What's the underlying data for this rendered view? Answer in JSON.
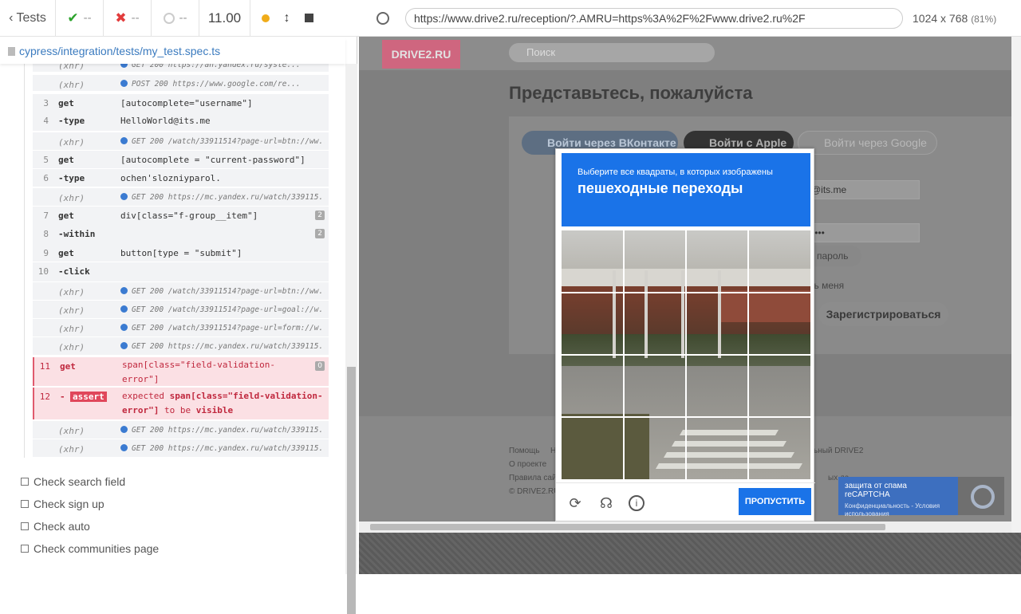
{
  "reporter": {
    "header": {
      "tests_label": "Tests",
      "passed": "--",
      "failed": "--",
      "pending": "--",
      "duration": "11.00"
    },
    "spec_path": "cypress/integration/tests/my_test.spec.ts",
    "commands": [
      {
        "type": "xhr",
        "name": "(xhr)",
        "msg": "GET 200 https://an.yandex.ru/syste..."
      },
      {
        "type": "xhr",
        "name": "(xhr)",
        "msg": "POST 200 https://www.google.com/re..."
      },
      {
        "num": "3",
        "name": "get",
        "msg": "[autocomplete=\"username\"]"
      },
      {
        "num": "4",
        "name": "-type",
        "msg": "HelloWorld@its.me"
      },
      {
        "type": "xhr",
        "name": "(xhr)",
        "msg": "GET 200 /watch/33911514?page-url=btn://ww..."
      },
      {
        "num": "5",
        "name": "get",
        "msg": "[autocomplete = \"current-password\"]"
      },
      {
        "num": "6",
        "name": "-type",
        "msg": "ochen'slozniyparol."
      },
      {
        "type": "xhr",
        "name": "(xhr)",
        "msg": "GET 200 https://mc.yandex.ru/watch/339115..."
      },
      {
        "num": "7",
        "name": "get",
        "msg": "div[class=\"f-group__item\"]",
        "badge": "2"
      },
      {
        "num": "8",
        "name": "-within",
        "msg": "",
        "badge": "2"
      },
      {
        "num": "9",
        "name": "get",
        "msg": "button[type = \"submit\"]"
      },
      {
        "num": "10",
        "name": "-click",
        "msg": ""
      },
      {
        "type": "xhr",
        "name": "(xhr)",
        "msg": "GET 200 /watch/33911514?page-url=btn://ww..."
      },
      {
        "type": "xhr",
        "name": "(xhr)",
        "msg": "GET 200 /watch/33911514?page-url=goal://w..."
      },
      {
        "type": "xhr",
        "name": "(xhr)",
        "msg": "GET 200 /watch/33911514?page-url=form://w..."
      },
      {
        "type": "xhr",
        "name": "(xhr)",
        "msg": "GET 200 https://mc.yandex.ru/watch/339115..."
      },
      {
        "type": "fail",
        "num": "11",
        "name": "get",
        "msg_line1": "span[class=\"field-validation-",
        "msg_line2": "error\"]",
        "badge": "0"
      },
      {
        "type": "fail",
        "num": "12",
        "name": "-",
        "tag": "assert",
        "msg_a": "expected",
        "msg_b": "span[class=\"field-validation-",
        "msg_c": "error\"]",
        "msg_d": "to be",
        "msg_e": "visible"
      },
      {
        "type": "xhr",
        "name": "(xhr)",
        "msg": "GET 200 https://mc.yandex.ru/watch/339115..."
      },
      {
        "type": "xhr",
        "name": "(xhr)",
        "msg": "GET 200 https://mc.yandex.ru/watch/339115..."
      }
    ],
    "suites": [
      "Check search field",
      "Check sign up",
      "Check auto",
      "Check communities page"
    ]
  },
  "aut": {
    "url": "https://www.drive2.ru/reception/?.AMRU=https%3A%2F%2Fwww.drive2.ru%2F",
    "viewport": "1024 x 768",
    "scale": "(81%)",
    "site": {
      "logo": "DRIVE2.RU",
      "search_placeholder": "Поиск",
      "title": "Представьтесь, пожалуйста",
      "vk_button": "Войти через ВКонтакте",
      "apple_button": "Войти с Apple",
      "google_button": "Войти через Google",
      "email_partial": "@its.me",
      "password_partial": "••••",
      "forgot_partial": "пароль",
      "remember_partial": "ть меня",
      "register": "Зарегистрироваться",
      "footer_left": [
        "Помощь",
        "О проекте",
        "Правила сай",
        "© DRIVE2.RU"
      ],
      "footer_n": "Н",
      "footer_right1": "ьный DRIVE2",
      "footer_right2": "ых да"
    },
    "recaptcha_badge": {
      "title": "защита от спама reCAPTCHA",
      "links": "Конфиденциальность - Условия использования"
    },
    "captcha": {
      "instruction": "Выберите все квадраты, в которых изображены",
      "target": "пешеходные переходы",
      "skip": "ПРОПУСТИТЬ"
    }
  }
}
